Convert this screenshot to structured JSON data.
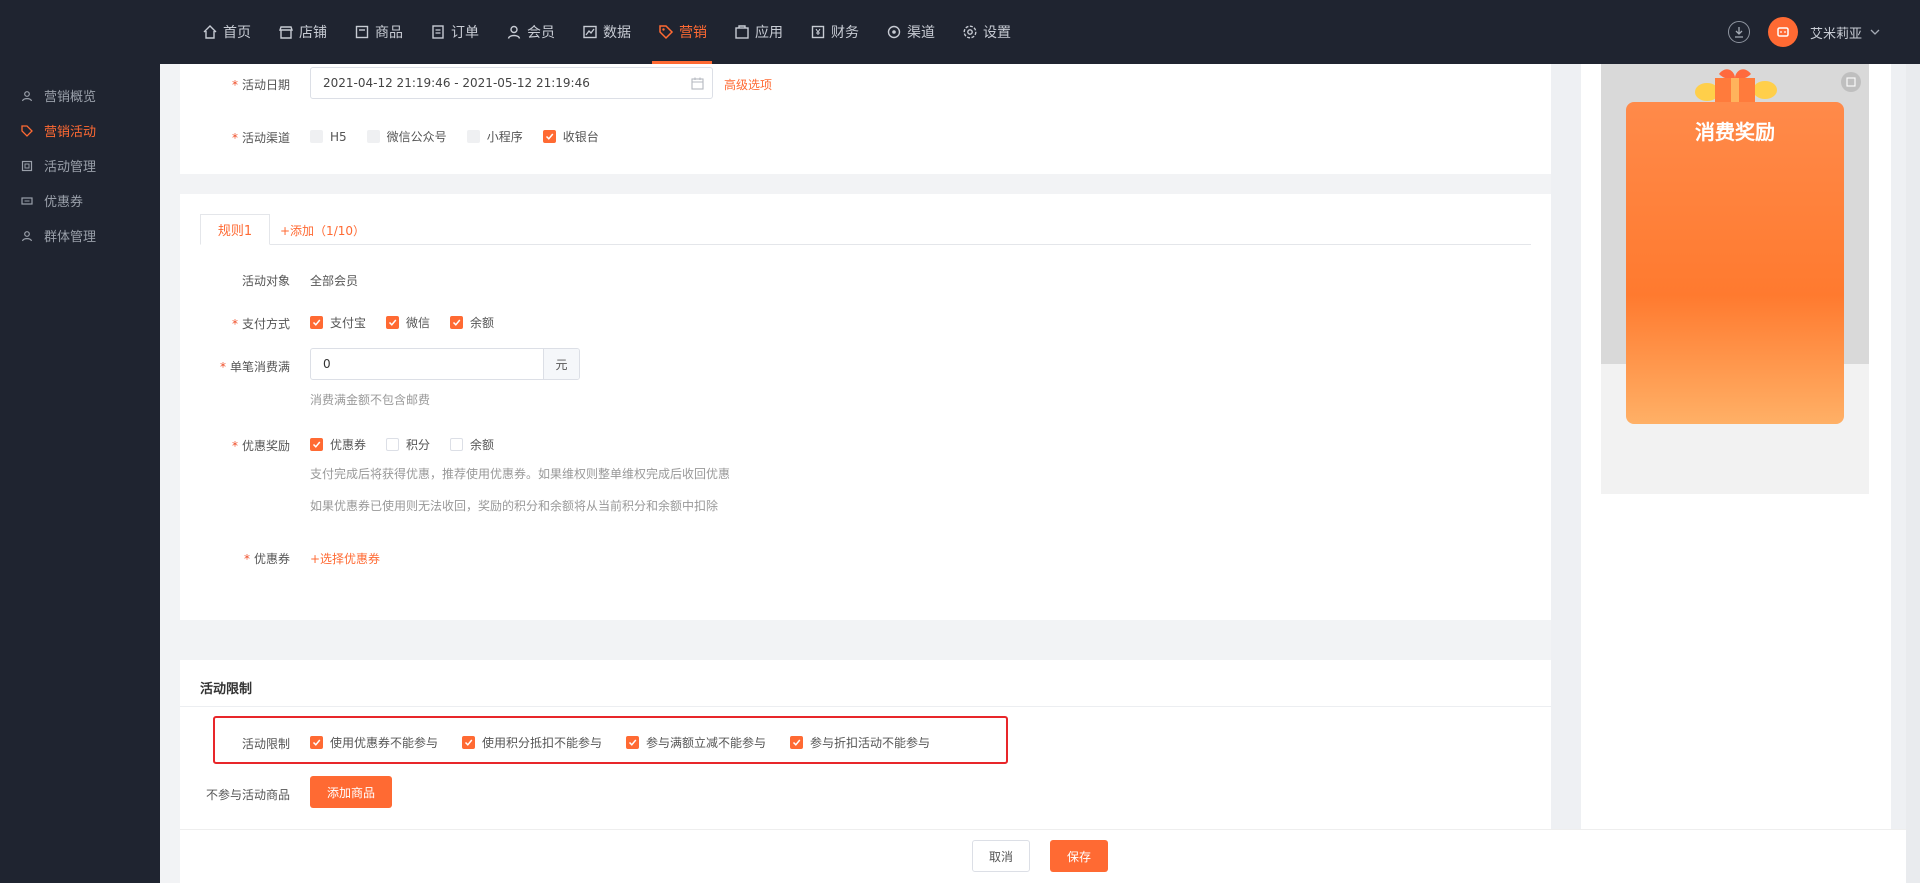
{
  "nav": {
    "items": [
      {
        "label": "首页",
        "icon": "home-icon"
      },
      {
        "label": "店铺",
        "icon": "store-icon"
      },
      {
        "label": "商品",
        "icon": "product-icon"
      },
      {
        "label": "订单",
        "icon": "order-icon"
      },
      {
        "label": "会员",
        "icon": "user-icon"
      },
      {
        "label": "数据",
        "icon": "chart-icon"
      },
      {
        "label": "营销",
        "icon": "tag-icon"
      },
      {
        "label": "应用",
        "icon": "app-icon"
      },
      {
        "label": "财务",
        "icon": "finance-icon"
      },
      {
        "label": "渠道",
        "icon": "channel-icon"
      },
      {
        "label": "设置",
        "icon": "gear-icon"
      }
    ],
    "active_color": "#ff6a33",
    "user_name": "艾米莉亚"
  },
  "sidebar": {
    "items": [
      {
        "label": "营销概览"
      },
      {
        "label": "营销活动"
      },
      {
        "label": "活动管理"
      },
      {
        "label": "优惠券"
      },
      {
        "label": "群体管理"
      }
    ]
  },
  "basic": {
    "date_label": "活动日期",
    "date_value": "2021-04-12 21:19:46 - 2021-05-12 21:19:46",
    "advanced_link": "高级选项",
    "channel_label": "活动渠道",
    "channels": [
      "H5",
      "微信公众号",
      "小程序",
      "收银台"
    ]
  },
  "rules": {
    "tab": "规则1",
    "add_link": "+添加（1/10）",
    "target_label": "活动对象",
    "target_value": "全部会员",
    "payment_label": "支付方式",
    "payments": [
      "支付宝",
      "微信",
      "余额"
    ],
    "min_label": "单笔消费满",
    "min_value": "0",
    "min_unit": "元",
    "min_hint": "消费满金额不包含邮费",
    "reward_label": "优惠奖励",
    "rewards": [
      "优惠券",
      "积分",
      "余额"
    ],
    "reward_hint1": "支付完成后将获得优惠，推荐使用优惠券。如果维权则整单维权完成后收回优惠",
    "reward_hint2": "如果优惠券已使用则无法收回，奖励的积分和余额将从当前积分和余额中扣除",
    "coupon_label": "优惠券",
    "coupon_link": "+选择优惠券"
  },
  "limits": {
    "section_title": "活动限制",
    "label": "活动限制",
    "options": [
      "使用优惠券不能参与",
      "使用积分抵扣不能参与",
      "参与满额立减不能参与",
      "参与折扣活动不能参与"
    ],
    "exclude_label": "不参与活动商品",
    "add_goods": "添加商品"
  },
  "preview": {
    "title": "消费奖励"
  },
  "footer": {
    "cancel": "取消",
    "save": "保存"
  }
}
